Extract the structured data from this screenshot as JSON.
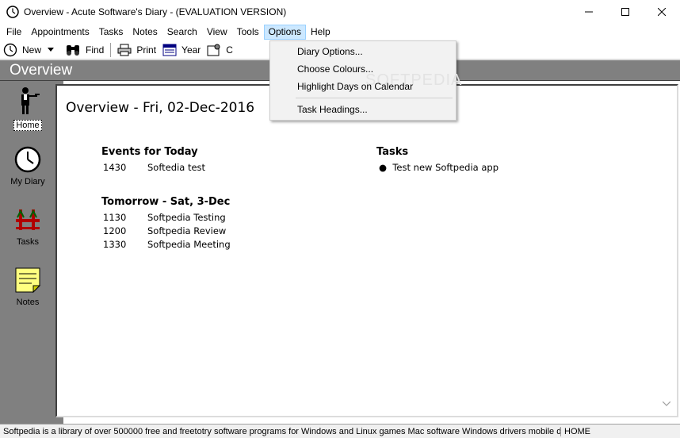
{
  "window": {
    "title": "Overview - Acute Software's Diary - (EVALUATION VERSION)"
  },
  "menu": [
    "File",
    "Appointments",
    "Tasks",
    "Notes",
    "Search",
    "View",
    "Tools",
    "Options",
    "Help"
  ],
  "toolbar": {
    "new_label": "New",
    "find_label": "Find",
    "print_label": "Print",
    "year_label": "Year",
    "partial_label": "C"
  },
  "header": {
    "title": "Overview"
  },
  "nav": {
    "home": "Home",
    "my_diary": "My Diary",
    "tasks": "Tasks",
    "notes": "Notes"
  },
  "overview": {
    "title": "Overview - Fri, 02-Dec-2016",
    "today_heading": "Events for Today",
    "today_events": [
      {
        "time": "1430",
        "text": "Softedia test"
      }
    ],
    "tomorrow_heading": "Tomorrow - Sat, 3-Dec",
    "tomorrow_events": [
      {
        "time": "1130",
        "text": "Softpedia Testing"
      },
      {
        "time": "1200",
        "text": "Softpedia Review"
      },
      {
        "time": "1330",
        "text": "Softpedia Meeting"
      }
    ],
    "tasks_heading": "Tasks",
    "tasks": [
      "Test new Softpedia app"
    ]
  },
  "options_menu": {
    "items": [
      "Diary Options...",
      "Choose Colours...",
      "Highlight Days on Calendar",
      "Task Headings..."
    ],
    "watermark": "SOFTPEDIA"
  },
  "status": {
    "left": "Softpedia is a library of over 500000 free and freetotry software programs for Windows and Linux games Mac software Windows drivers mobile device",
    "right": "HOME"
  },
  "colors": {
    "panel_gray": "#808080",
    "menu_highlight": "#cce8ff",
    "notes_yellow": "#ffff80"
  }
}
